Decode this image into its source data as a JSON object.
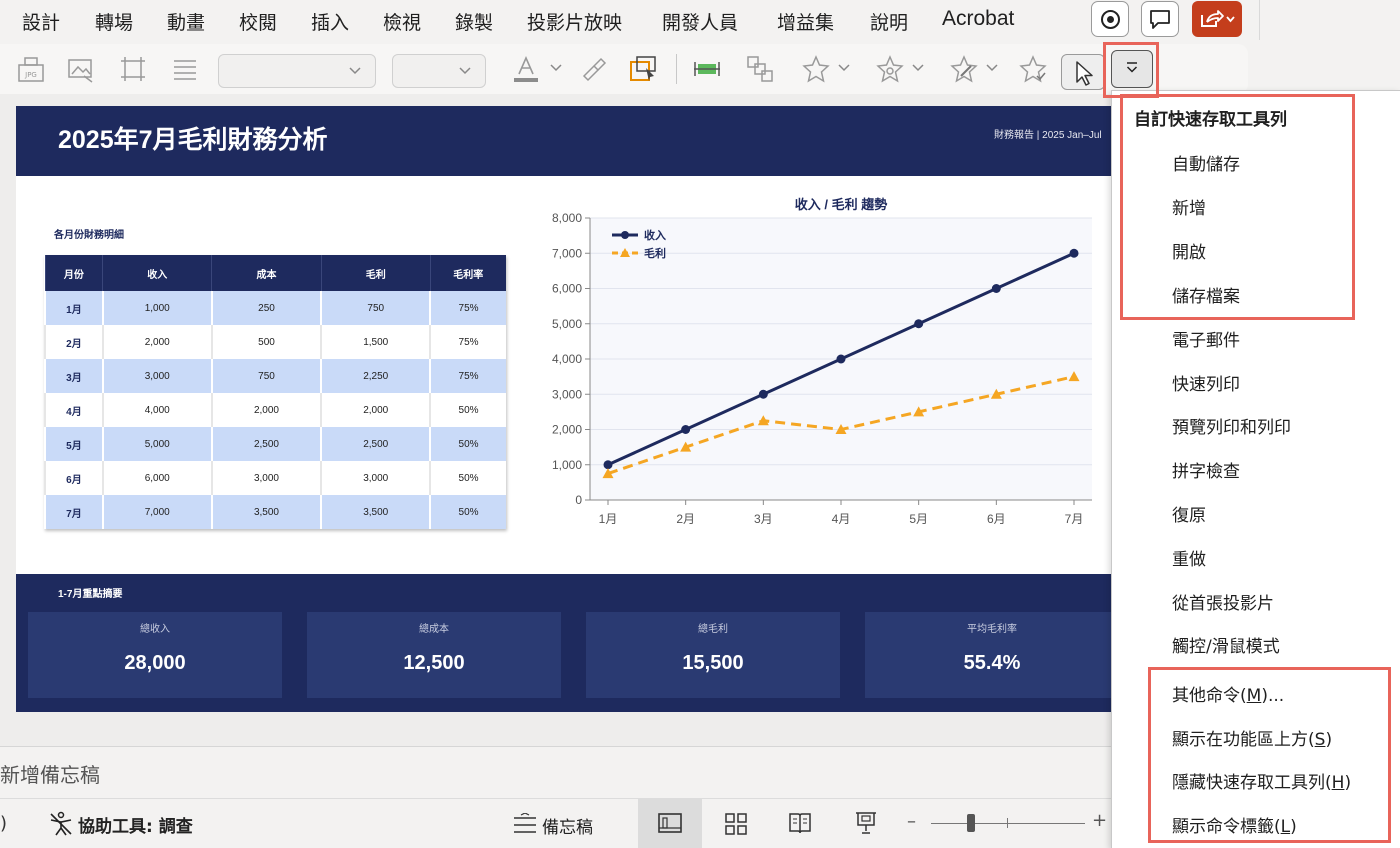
{
  "menubar": {
    "tabs": [
      "設計",
      "轉場",
      "動畫",
      "校閱",
      "插入",
      "檢視",
      "錄製",
      "投影片放映",
      "開發人員",
      "增益集",
      "說明",
      "Acrobat"
    ]
  },
  "ribbon": {
    "icons": [
      "jpg-picture-icon",
      "change-picture-icon",
      "crop-icon",
      "align-text-icon",
      "font-color-icon",
      "format-painter-icon",
      "shape-select-icon",
      "align-distribute-icon",
      "arrange-icon",
      "star-effect-icon",
      "star-gear-icon",
      "star-pen-icon",
      "star-check-icon"
    ],
    "colors": {
      "font_color_bar": "#8c8c8c",
      "accent": "#e58a00"
    }
  },
  "qat_menu": {
    "title": "自訂快速存取工具列",
    "items": [
      "自動儲存",
      "新增",
      "開啟",
      "儲存檔案",
      "電子郵件",
      "快速列印",
      "預覽列印和列印",
      "拼字檢查",
      "復原",
      "重做",
      "從首張投影片",
      "觸控/滑鼠模式"
    ],
    "more_commands": {
      "text": "其他命令(",
      "key": "M",
      "suffix": ")..."
    },
    "show_above": {
      "text": "顯示在功能區上方(",
      "key": "S",
      "suffix": ")"
    },
    "hide_qat": {
      "text": "隱藏快速存取工具列(",
      "key": "H",
      "suffix": ")"
    },
    "show_labels": {
      "text": "顯示命令標籤(",
      "key": "L",
      "suffix": ")"
    }
  },
  "slide": {
    "title": "2025年7月毛利財務分析",
    "subtitle": "財務報告 | 2025 Jan–Jul",
    "table_caption": "各月份財務明細",
    "table": {
      "headers": [
        "月份",
        "收入",
        "成本",
        "毛利",
        "毛利率"
      ],
      "rows": [
        [
          "1月",
          "1,000",
          "250",
          "750",
          "75%"
        ],
        [
          "2月",
          "2,000",
          "500",
          "1,500",
          "75%"
        ],
        [
          "3月",
          "3,000",
          "750",
          "2,250",
          "75%"
        ],
        [
          "4月",
          "4,000",
          "2,000",
          "2,000",
          "50%"
        ],
        [
          "5月",
          "5,000",
          "2,500",
          "2,500",
          "50%"
        ],
        [
          "6月",
          "6,000",
          "3,000",
          "3,000",
          "50%"
        ],
        [
          "7月",
          "7,000",
          "3,500",
          "3,500",
          "50%"
        ]
      ]
    },
    "summary": {
      "title": "1-7月重點摘要",
      "cards": [
        {
          "label": "總收入",
          "value": "28,000"
        },
        {
          "label": "總成本",
          "value": "12,500"
        },
        {
          "label": "總毛利",
          "value": "15,500"
        },
        {
          "label": "平均毛利率",
          "value": "55.4%"
        }
      ]
    }
  },
  "chart_data": {
    "type": "line",
    "title": "收入 / 毛利 趨勢",
    "categories": [
      "1月",
      "2月",
      "3月",
      "4月",
      "5月",
      "6月",
      "7月"
    ],
    "series": [
      {
        "name": "收入",
        "values": [
          1000,
          2000,
          3000,
          4000,
          5000,
          6000,
          7000
        ],
        "color": "#1e2a5e",
        "marker": "circle",
        "dash": "solid"
      },
      {
        "name": "毛利",
        "values": [
          750,
          1500,
          2250,
          2000,
          2500,
          3000,
          3500
        ],
        "color": "#f5a623",
        "marker": "triangle",
        "dash": "dashed"
      }
    ],
    "ylim": [
      0,
      8000
    ],
    "yticks": [
      "0",
      "1,000",
      "2,000",
      "3,000",
      "4,000",
      "5,000",
      "6,000",
      "7,000",
      "8,000"
    ],
    "grid": true,
    "legend": "top-left"
  },
  "notes": {
    "placeholder": "新增備忘稿"
  },
  "status": {
    "left_paren": ")",
    "accessibility": "協助工具: 調查",
    "notes_button": "備忘稿",
    "zoom_minus": "–",
    "zoom_plus": "+"
  }
}
